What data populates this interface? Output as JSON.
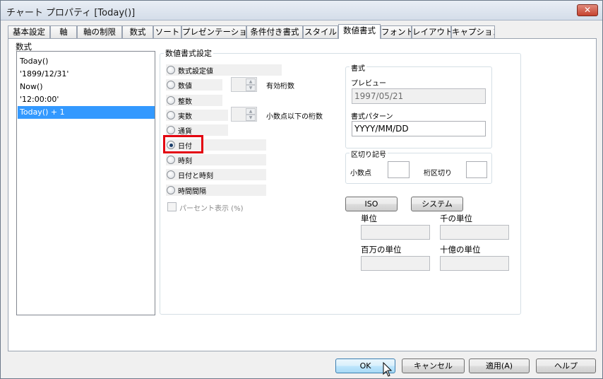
{
  "window": {
    "title": "チャート プロパティ [Today()]",
    "close_label": "✕"
  },
  "tabs": [
    {
      "label": "基本設定"
    },
    {
      "label": "軸"
    },
    {
      "label": "軸の制限"
    },
    {
      "label": "数式"
    },
    {
      "label": "ソート"
    },
    {
      "label": "プレゼンテーション"
    },
    {
      "label": "条件付き書式"
    },
    {
      "label": "スタイル"
    },
    {
      "label": "数値書式"
    },
    {
      "label": "フォント"
    },
    {
      "label": "レイアウト"
    },
    {
      "label": "キャプション"
    }
  ],
  "active_tab": "数値書式",
  "expressions": {
    "label": "数式",
    "items": [
      "Today()",
      "'1899/12/31'",
      "Now()",
      "'12:00:00'",
      "Today() + 1"
    ],
    "selected_item": "Today() + 1"
  },
  "number_format": {
    "group_label": "数値書式設定",
    "options": [
      "数式設定値",
      "数値",
      "整数",
      "実数",
      "通貨",
      "日付",
      "時刻",
      "日付と時刻",
      "時間間隔"
    ],
    "selected_option": "日付",
    "significant_digits_label": "有効桁数",
    "decimal_digits_label": "小数点以下の桁数",
    "percent_label": "パーセント表示 (%)"
  },
  "format": {
    "group_label": "書式",
    "preview_label": "プレビュー",
    "preview_value": "1997/05/21",
    "pattern_label": "書式パターン",
    "pattern_value": "YYYY/MM/DD"
  },
  "separator": {
    "group_label": "区切り記号",
    "decimal_label": "小数点",
    "thousand_label": "桁区切り"
  },
  "buttons": {
    "iso": "ISO",
    "system": "システム"
  },
  "units": {
    "unit_label": "単位",
    "thousand_label": "千の単位",
    "million_label": "百万の単位",
    "billion_label": "十億の単位"
  },
  "footer": {
    "ok": "OK",
    "cancel": "キャンセル",
    "apply": "適用(A)",
    "help": "ヘルプ"
  }
}
